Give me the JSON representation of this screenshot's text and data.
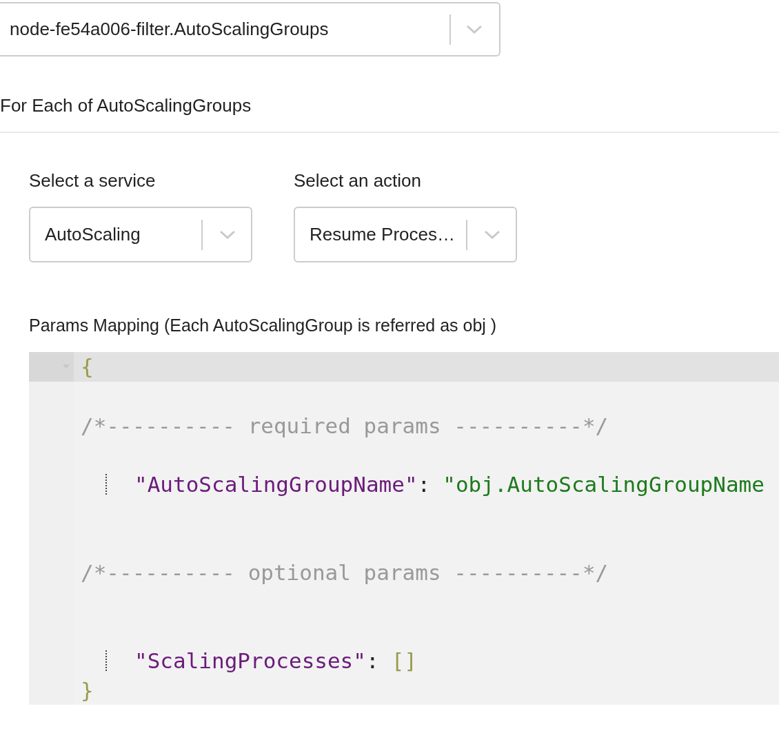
{
  "source_select": {
    "value": "node-fe54a006-filter.AutoScalingGroups"
  },
  "section_title": "For Each of AutoScalingGroups",
  "selects": [
    {
      "label": "Select a service",
      "value": "AutoScaling"
    },
    {
      "label": "Select an action",
      "value": "Resume Proces…"
    }
  ],
  "params_label": "Params Mapping (Each AutoScalingGroup is referred as obj )",
  "editor": {
    "lines": [
      {
        "kind": "brace",
        "text": "{",
        "active": true
      },
      {
        "kind": "blank",
        "active": false
      },
      {
        "kind": "comment",
        "text": "/*---------- required params ----------*/",
        "active": false
      },
      {
        "kind": "blank",
        "active": false
      },
      {
        "kind": "string_pair",
        "key": "\"AutoScalingGroupName\"",
        "colon": ":",
        "value": "\"obj.AutoScalingGroupName",
        "active": false
      },
      {
        "kind": "blank",
        "active": false
      },
      {
        "kind": "blank",
        "active": false
      },
      {
        "kind": "comment",
        "text": "/*---------- optional params ----------*/",
        "active": false
      },
      {
        "kind": "blank",
        "active": false
      },
      {
        "kind": "blank",
        "active": false
      },
      {
        "kind": "array_pair",
        "key": "\"ScalingProcesses\"",
        "colon": ":",
        "value": "[]",
        "active": false
      },
      {
        "kind": "brace",
        "text": "}",
        "active": false
      }
    ]
  }
}
